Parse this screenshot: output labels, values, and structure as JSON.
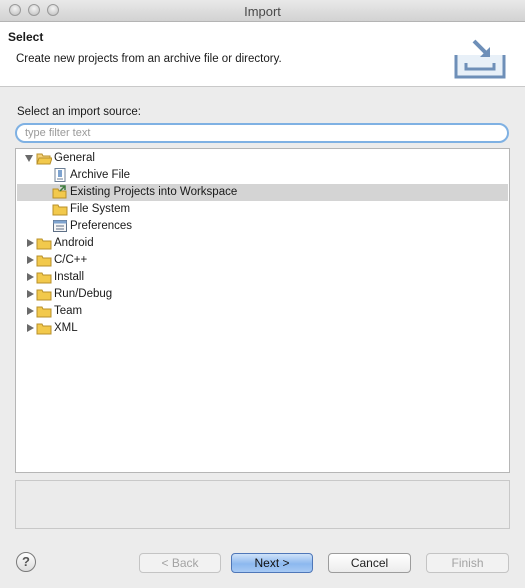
{
  "window": {
    "title": "Import"
  },
  "header": {
    "title": "Select",
    "description": "Create new projects from an archive file or directory."
  },
  "source": {
    "label": "Select an import source:",
    "filter_placeholder": "type filter text"
  },
  "tree": {
    "items": [
      {
        "label": "General",
        "expanded": true,
        "icon": "folder-open-icon"
      },
      {
        "label": "Archive File",
        "icon": "archive-file-icon"
      },
      {
        "label": "Existing Projects into Workspace",
        "icon": "import-projects-icon",
        "selected": true
      },
      {
        "label": "File System",
        "icon": "folder-icon"
      },
      {
        "label": "Preferences",
        "icon": "preferences-icon"
      },
      {
        "label": "Android",
        "expanded": false,
        "icon": "folder-icon"
      },
      {
        "label": "C/C++",
        "expanded": false,
        "icon": "folder-icon"
      },
      {
        "label": "Install",
        "expanded": false,
        "icon": "folder-icon"
      },
      {
        "label": "Run/Debug",
        "expanded": false,
        "icon": "folder-icon"
      },
      {
        "label": "Team",
        "expanded": false,
        "icon": "folder-icon"
      },
      {
        "label": "XML",
        "expanded": false,
        "icon": "folder-icon"
      }
    ]
  },
  "buttons": {
    "help": "?",
    "back": "< Back",
    "next": "Next >",
    "cancel": "Cancel",
    "finish": "Finish"
  },
  "colors": {
    "accent": "#8cb8ef",
    "selection": "#d4d4d4",
    "folder": "#f2c94c"
  }
}
